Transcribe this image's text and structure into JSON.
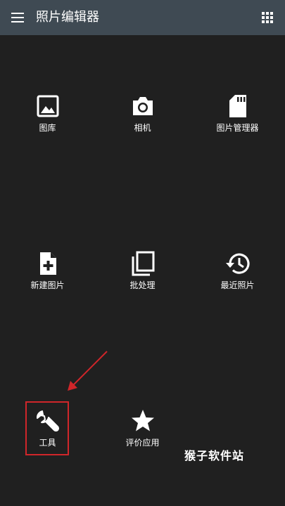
{
  "app": {
    "title": "照片编辑器"
  },
  "toolbar": {
    "menu_icon": "hamburger-menu-icon",
    "grid_icon": "apps-grid-icon"
  },
  "menu": {
    "items": [
      {
        "label": "图库",
        "icon": "image-icon"
      },
      {
        "label": "相机",
        "icon": "camera-icon"
      },
      {
        "label": "图片管理器",
        "icon": "sd-card-icon"
      },
      {
        "label": "新建图片",
        "icon": "new-file-icon"
      },
      {
        "label": "批处理",
        "icon": "batch-copy-icon"
      },
      {
        "label": "最近照片",
        "icon": "history-icon"
      },
      {
        "label": "工具",
        "icon": "wrench-icon"
      },
      {
        "label": "评价应用",
        "icon": "star-icon"
      }
    ]
  },
  "annotation": {
    "color": "#d0262a"
  },
  "watermark": {
    "text": "猴子软件站"
  },
  "colors": {
    "toolbar": "#3f4a53",
    "background": "#202020",
    "icon": "#ffffff"
  }
}
